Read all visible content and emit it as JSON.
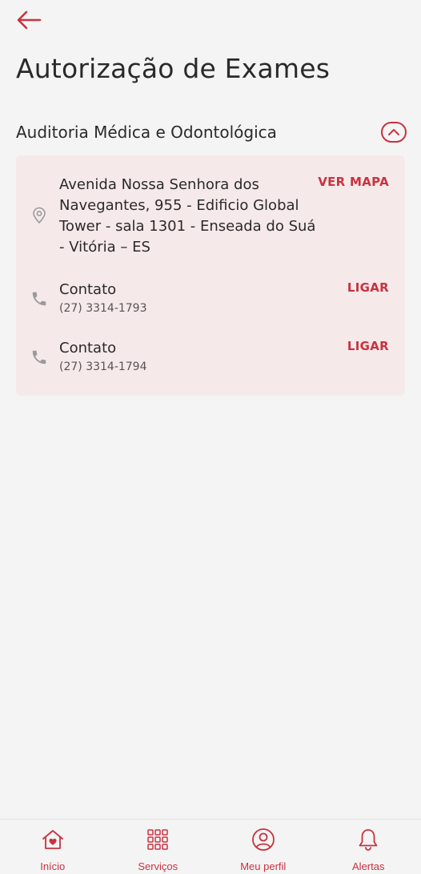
{
  "header": {
    "title": "Autorização de Exames"
  },
  "section": {
    "title": "Auditoria Médica e Odontológica"
  },
  "card": {
    "address": {
      "text": "Avenida Nossa Senhora dos Navegantes, 955 - Edificio Global Tower - sala 1301 - Enseada do Suá - Vitória – ES",
      "action": "VER MAPA"
    },
    "contacts": [
      {
        "label": "Contato",
        "phone": "(27) 3314-1793",
        "action": "LIGAR"
      },
      {
        "label": "Contato",
        "phone": "(27) 3314-1794",
        "action": "LIGAR"
      }
    ]
  },
  "nav": {
    "items": [
      {
        "label": "Início",
        "icon": "home-heart-icon"
      },
      {
        "label": "Serviços",
        "icon": "grid-icon"
      },
      {
        "label": "Meu perfil",
        "icon": "user-circle-icon"
      },
      {
        "label": "Alertas",
        "icon": "bell-icon"
      }
    ]
  },
  "colors": {
    "accent": "#c9323f",
    "card_background": "#f6e9ea",
    "background": "#f4f4f4"
  }
}
